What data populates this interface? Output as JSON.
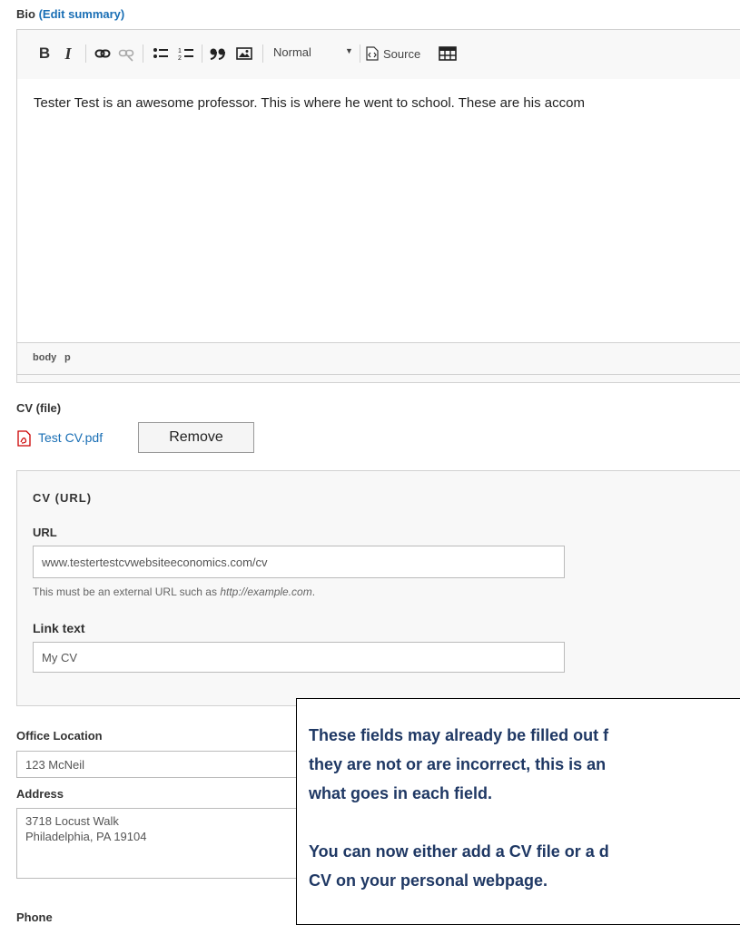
{
  "bio": {
    "label": "Bio",
    "paren_open": "(",
    "edit_summary": "Edit summary",
    "paren_close": ")",
    "toolbar": {
      "bold": "B",
      "italic": "I",
      "format_value": "Normal",
      "source_label": "Source"
    },
    "content": "Tester Test is an awesome professor. This is where he went to school. These are his accom",
    "path": [
      "body",
      "p"
    ]
  },
  "cv_file": {
    "label": "CV (file)",
    "filename": "Test CV.pdf",
    "remove_label": "Remove"
  },
  "cv_url": {
    "legend": "CV (URL)",
    "url_label": "URL",
    "url_value": "www.testertestcvwebsiteeconomics.com/cv",
    "url_desc_prefix": "This must be an external URL such as ",
    "url_desc_example": "http://example.com",
    "url_desc_suffix": ".",
    "link_text_label": "Link text",
    "link_text_value": "My CV"
  },
  "office": {
    "label": "Office Location",
    "value": "123 McNeil"
  },
  "address": {
    "label": "Address",
    "line1": "3718 Locust Walk",
    "line2": "Philadelphia, PA 19104"
  },
  "phone": {
    "label": "Phone"
  },
  "callout": {
    "line1": "These fields may already be filled out f",
    "line2": "they are not or are incorrect, this is an",
    "line3": "what goes in each field.",
    "line4": "You can now either add a CV file or a d",
    "line5": "CV on your personal webpage."
  },
  "colors": {
    "link": "#1a6fb5",
    "callout_text": "#1f3864"
  }
}
